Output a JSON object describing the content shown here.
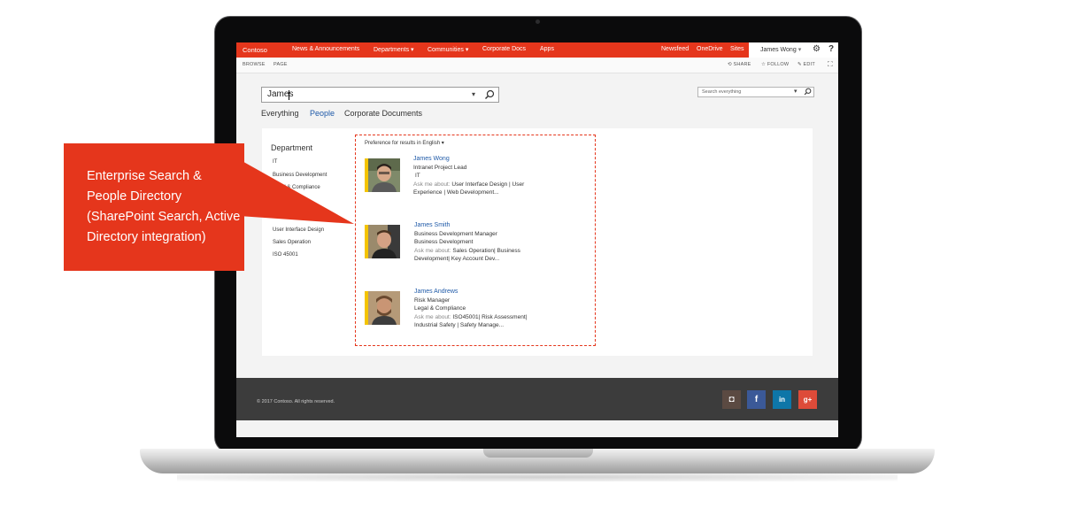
{
  "topnav": {
    "brand": "Contoso",
    "items": [
      "News & Announcements",
      "Departments",
      "Communities",
      "Corporate Docs",
      "Apps"
    ],
    "right_links": [
      "Newsfeed",
      "OneDrive",
      "Sites"
    ],
    "user": "James Wong"
  },
  "ribbon": {
    "left": [
      "BROWSE",
      "PAGE"
    ],
    "actions": [
      "SHARE",
      "FOLLOW",
      "EDIT"
    ]
  },
  "search": {
    "query": "James",
    "mini_placeholder": "Search everything"
  },
  "tabs": [
    "Everything",
    "People",
    "Corporate Documents"
  ],
  "refiner": {
    "title": "Department",
    "items": [
      "IT",
      "Business Development",
      "Legal & Compliance",
      "User Interface Design",
      "Sales Operation",
      "ISO 45001"
    ]
  },
  "results": {
    "preference": "Preference for results in English",
    "ask_label": "Ask me about:",
    "people": [
      {
        "name": "James Wong",
        "title": "Intranet Project Lead",
        "dept": "IT",
        "ask1": "User Interface Design | User",
        "ask2": "Experience | Web Development..."
      },
      {
        "name": "James Smith",
        "title": "Business Development Manager",
        "dept": "Business Development",
        "ask1": "Sales Operation| Business",
        "ask2": "Development| Key Account Dev..."
      },
      {
        "name": "James Andrews",
        "title": "Risk Manager",
        "dept": "Legal & Compliance",
        "ask1": "ISO45001| Risk Assessment|",
        "ask2": "Industrial Safety | Safety Manage..."
      }
    ]
  },
  "footer": {
    "copyright": "© 2017 Contoso. All rights reserved.",
    "social": [
      {
        "name": "instagram",
        "glyph": "◘",
        "color": "#5b4a42"
      },
      {
        "name": "facebook",
        "glyph": "f",
        "color": "#3b5998"
      },
      {
        "name": "linkedin",
        "glyph": "in",
        "color": "#0e76a8"
      },
      {
        "name": "googleplus",
        "glyph": "g+",
        "color": "#dd4b39"
      }
    ]
  },
  "callout": {
    "lines": [
      "Enterprise Search &",
      "People Directory",
      "(SharePoint Search, Active",
      "Directory integration)"
    ]
  },
  "colors": {
    "accent": "#e5361c",
    "link": "#1f5aa8",
    "footer": "#3c3c3c"
  }
}
